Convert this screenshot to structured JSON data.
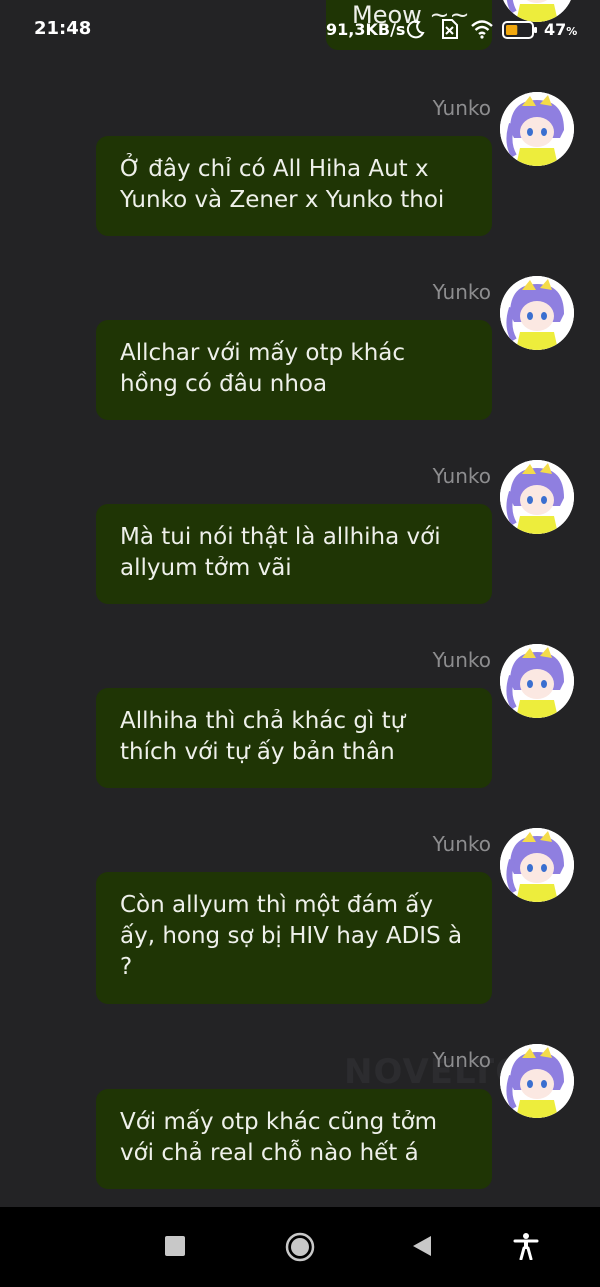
{
  "status_bar": {
    "time": "21:48",
    "net_speed": "91,3KB/s",
    "battery": "47",
    "battery_unit": "%",
    "icons": [
      "moon-icon",
      "no-sim-icon",
      "wifi-icon",
      "battery-icon"
    ]
  },
  "chat": {
    "watermark": "NOVELTO",
    "top_message": "Meow ~~",
    "messages": [
      {
        "sender": "Yunko",
        "text": "Ở đây chỉ có All Hiha Aut x Yunko và Zener x Yunko thoi"
      },
      {
        "sender": "Yunko",
        "text": "Allchar với mấy otp khác hồng có đâu nhoa"
      },
      {
        "sender": "Yunko",
        "text": "Mà tui nói thật là allhiha với allyum tởm vãi"
      },
      {
        "sender": "Yunko",
        "text": "Allhiha thì chả khác gì tự thích với tự ấy bản thân"
      },
      {
        "sender": "Yunko",
        "text": "Còn allyum thì một đám ấy ấy, hong sợ bị HIV hay ADIS à ?"
      },
      {
        "sender": "Yunko",
        "text": "Với mấy otp khác cũng tởm với chả real chỗ nào hết á"
      }
    ]
  },
  "nav_bar": {
    "buttons": [
      "recents-square-icon",
      "home-circle-icon",
      "back-triangle-icon",
      "accessibility-icon"
    ]
  },
  "colors": {
    "background": "#232325",
    "bubble": "#1f3505",
    "sender_name": "#8d8d8f",
    "nav_bar": "#000000"
  }
}
